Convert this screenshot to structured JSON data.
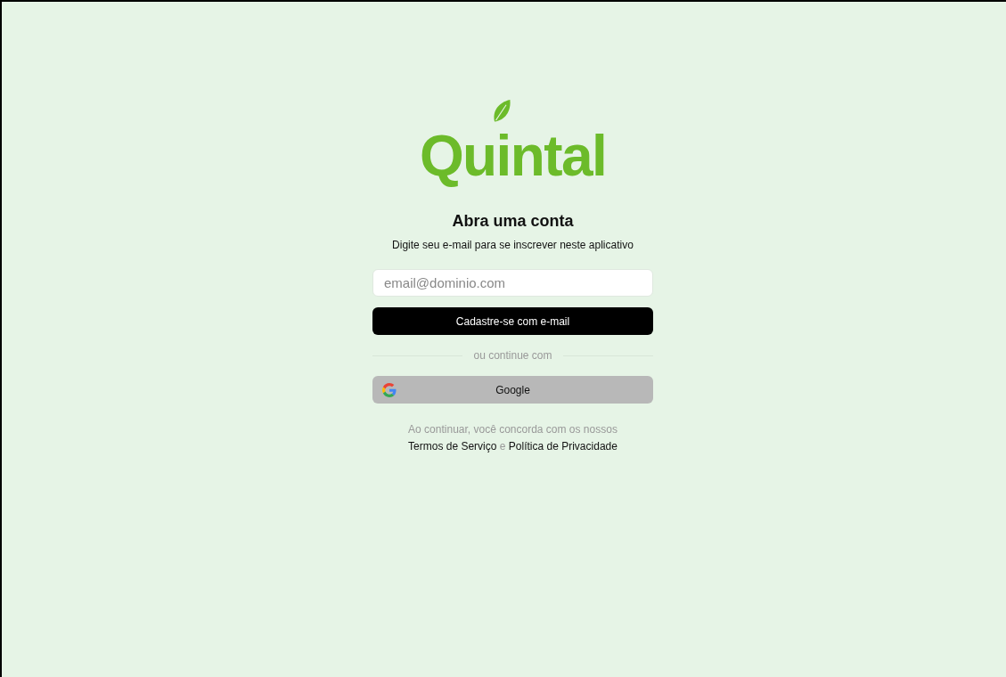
{
  "logo": {
    "text": "Quintal"
  },
  "heading": "Abra uma conta",
  "subheading": "Digite seu e-mail para se inscrever neste aplicativo",
  "email_field": {
    "placeholder": "email@dominio.com"
  },
  "signup_button": "Cadastre-se com e-mail",
  "divider_text": "ou continue com",
  "google_button": "Google",
  "legal": {
    "text_before": "Ao continuar, você concorda com os nossos",
    "terms_link": "Termos de Serviço",
    "text_between": "e",
    "privacy_link": "Política de Privacidade"
  }
}
